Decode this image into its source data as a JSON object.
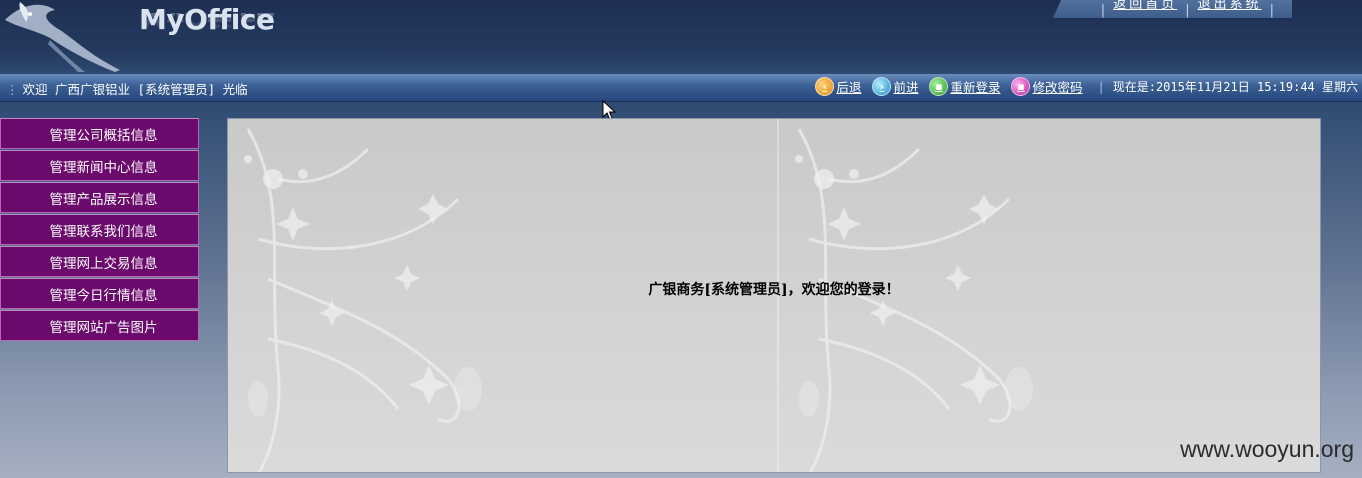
{
  "header": {
    "logo_text": "MyOffice",
    "top_links": [
      "返回首页",
      "退出系统"
    ]
  },
  "navbar": {
    "welcome": "欢迎 广西广银铝业 [系统管理员] 光临",
    "buttons": [
      {
        "label": "后退",
        "icon": "arrow-left-icon"
      },
      {
        "label": "前进",
        "icon": "arrow-right-icon"
      },
      {
        "label": "重新登录",
        "icon": "relogin-icon"
      },
      {
        "label": "修改密码",
        "icon": "lock-icon"
      }
    ],
    "datetime": "现在是:2015年11月21日 15:19:44 星期六"
  },
  "sidebar": {
    "items": [
      {
        "label": "管理公司概括信息"
      },
      {
        "label": "管理新闻中心信息"
      },
      {
        "label": "管理产品展示信息"
      },
      {
        "label": "管理联系我们信息"
      },
      {
        "label": "管理网上交易信息"
      },
      {
        "label": "管理今日行情信息"
      },
      {
        "label": "管理网站广告图片"
      }
    ]
  },
  "main": {
    "welcome_message": "广银商务[系统管理员]，欢迎您的登录！"
  },
  "watermark": "www.wooyun.org",
  "colors": {
    "sidebar_bg": "#6b0a6c",
    "header_bg": "#24395f",
    "panel_bg": "#cccccc"
  }
}
